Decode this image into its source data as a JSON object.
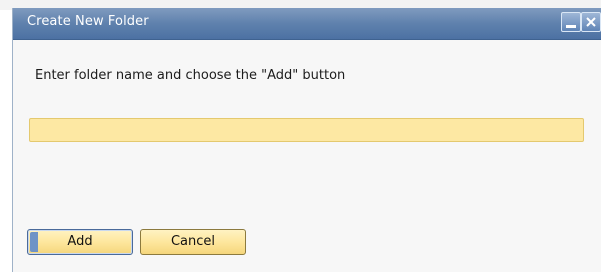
{
  "window": {
    "title": "Create New Folder",
    "minimize_icon": "minimize-icon",
    "close_icon": "close-icon"
  },
  "dialog": {
    "message": "Enter folder name and choose the \"Add\" button",
    "folder_name_value": "",
    "folder_name_placeholder": ""
  },
  "buttons": {
    "add_label": "Add",
    "cancel_label": "Cancel"
  },
  "colors": {
    "titlebar": "#5f81ad",
    "input_background": "#fde8a3",
    "button_background": "#fde59a",
    "focus_accent": "#6f93c6"
  }
}
